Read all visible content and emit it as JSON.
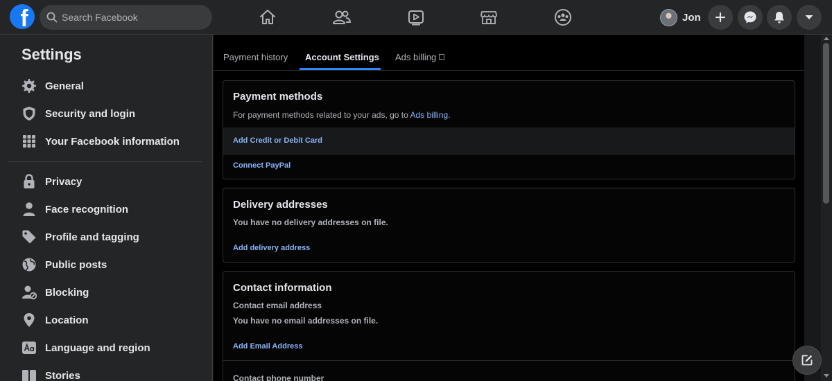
{
  "topbar": {
    "logo_letter": "f",
    "search": {
      "placeholder": "Search Facebook"
    },
    "nav": [
      "home-icon",
      "friends-icon",
      "watch-icon",
      "marketplace-icon",
      "groups-icon"
    ],
    "profile_name": "Jon",
    "buttons": [
      "plus-icon",
      "messenger-icon",
      "notifications-bell-icon",
      "account-menu-caret-icon"
    ]
  },
  "sidebar": {
    "title": "Settings",
    "items": [
      {
        "label": "General",
        "icon": "gear-icon"
      },
      {
        "label": "Security and login",
        "icon": "shield-icon"
      },
      {
        "label": "Your Facebook information",
        "icon": "grid-icon"
      },
      {
        "label": "Privacy",
        "icon": "lock-icon"
      },
      {
        "label": "Face recognition",
        "icon": "person-icon"
      },
      {
        "label": "Profile and tagging",
        "icon": "tag-icon"
      },
      {
        "label": "Public posts",
        "icon": "globe-icon"
      },
      {
        "label": "Blocking",
        "icon": "blocked-person-icon"
      },
      {
        "label": "Location",
        "icon": "location-pin-icon"
      },
      {
        "label": "Language and region",
        "icon": "language-aa-icon"
      },
      {
        "label": "Stories",
        "icon": "stories-book-icon"
      }
    ]
  },
  "tabs": [
    {
      "label": "Payment history",
      "active": false
    },
    {
      "label": "Account Settings",
      "active": true
    },
    {
      "label": "Ads billing",
      "active": false
    }
  ],
  "payment_methods": {
    "title": "Payment methods",
    "description": "For payment methods related to your ads, go to",
    "ads_billing_link": "Ads billing",
    "period": ".",
    "add_card": "Add Credit or Debit Card",
    "connect_paypal": "Connect PayPal"
  },
  "delivery_addresses": {
    "title": "Delivery addresses",
    "empty_text": "You have no delivery addresses on file.",
    "add_link": "Add delivery address"
  },
  "contact_information": {
    "title": "Contact information",
    "email_heading": "Contact email address",
    "email_empty": "You have no email addresses on file.",
    "add_email": "Add Email Address",
    "phone_heading": "Contact phone number"
  },
  "colors": {
    "accent": "#2d88ff",
    "link": "#8ab4f8",
    "facebook_blue": "#1877f2",
    "surface": "#242526",
    "background": "#000000"
  }
}
